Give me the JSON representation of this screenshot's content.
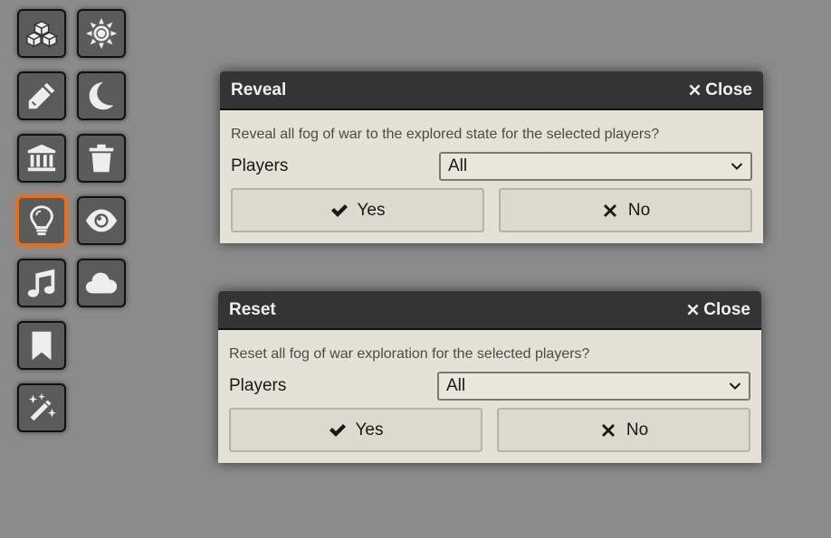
{
  "sidebar": {
    "buttons": [
      {
        "icon": "cubes-icon",
        "active": false
      },
      {
        "icon": "sun-icon",
        "active": false
      },
      {
        "icon": "pencil-icon",
        "active": false
      },
      {
        "icon": "moon-icon",
        "active": false
      },
      {
        "icon": "landmark-icon",
        "active": false
      },
      {
        "icon": "trash-icon",
        "active": false
      },
      {
        "icon": "lightbulb-icon",
        "active": true
      },
      {
        "icon": "eye-icon",
        "active": false
      },
      {
        "icon": "music-icon",
        "active": false
      },
      {
        "icon": "cloud-icon",
        "active": false
      },
      {
        "icon": "bookmark-icon",
        "active": false
      },
      {
        "icon": "magic-wand-icon",
        "active": false
      }
    ]
  },
  "reveal_dialog": {
    "title": "Reveal",
    "close_label": "Close",
    "message": "Reveal all fog of war to the explored state for the selected players?",
    "players_label": "Players",
    "players_value": "All",
    "yes_label": "Yes",
    "no_label": "No"
  },
  "reset_dialog": {
    "title": "Reset",
    "close_label": "Close",
    "message": "Reset all fog of war exploration for the selected players?",
    "players_label": "Players",
    "players_value": "All",
    "yes_label": "Yes",
    "no_label": "No"
  },
  "colors": {
    "background": "#8b8b8b",
    "active_control": "#ff6400",
    "dialog_header": "#343434",
    "dialog_body": "#e4e1d7"
  }
}
